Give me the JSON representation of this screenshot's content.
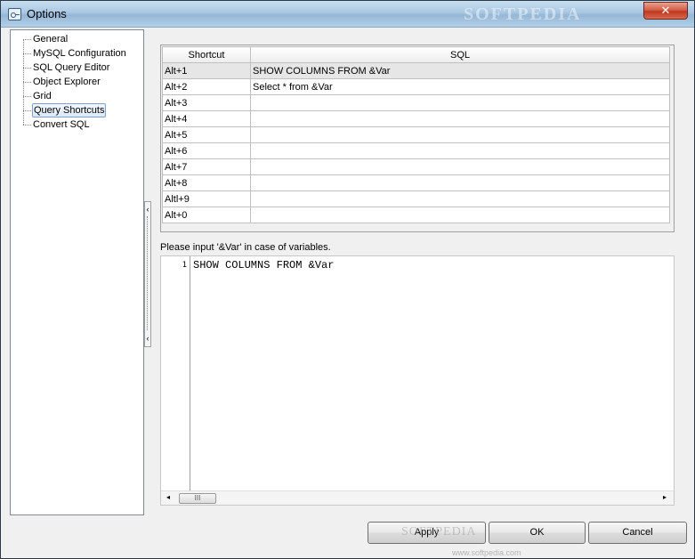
{
  "window": {
    "title": "Options",
    "close_label": "✕",
    "watermark": "SOFTPEDIA",
    "watermark_url": "www.softpedia.com"
  },
  "tree": {
    "items": [
      {
        "label": "General",
        "selected": false
      },
      {
        "label": "MySQL Configuration",
        "selected": false
      },
      {
        "label": "SQL Query Editor",
        "selected": false
      },
      {
        "label": "Object Explorer",
        "selected": false
      },
      {
        "label": "Grid",
        "selected": false
      },
      {
        "label": "Query Shortcuts",
        "selected": true
      },
      {
        "label": "Convert SQL",
        "selected": false
      }
    ]
  },
  "splitter": {
    "arrow_top": "‹",
    "arrow_bottom": "‹"
  },
  "shortcuts": {
    "columns": [
      "Shortcut",
      "SQL"
    ],
    "rows": [
      {
        "shortcut": "Alt+1",
        "sql": "SHOW COLUMNS FROM &Var"
      },
      {
        "shortcut": "Alt+2",
        "sql": "Select * from &Var"
      },
      {
        "shortcut": "Alt+3",
        "sql": ""
      },
      {
        "shortcut": "Alt+4",
        "sql": ""
      },
      {
        "shortcut": "Alt+5",
        "sql": ""
      },
      {
        "shortcut": "Alt+6",
        "sql": ""
      },
      {
        "shortcut": "Alt+7",
        "sql": ""
      },
      {
        "shortcut": "Alt+8",
        "sql": ""
      },
      {
        "shortcut": "Altl+9",
        "sql": ""
      },
      {
        "shortcut": "Alt+0",
        "sql": ""
      }
    ]
  },
  "hint": "Please input '&Var' in case of variables.",
  "editor": {
    "line_number": "1",
    "code": "SHOW COLUMNS FROM &Var",
    "scroll_left": "◂",
    "scroll_right": "▸",
    "thumb_grip": "III"
  },
  "buttons": {
    "apply": "Apply",
    "ok": "OK",
    "cancel": "Cancel"
  }
}
